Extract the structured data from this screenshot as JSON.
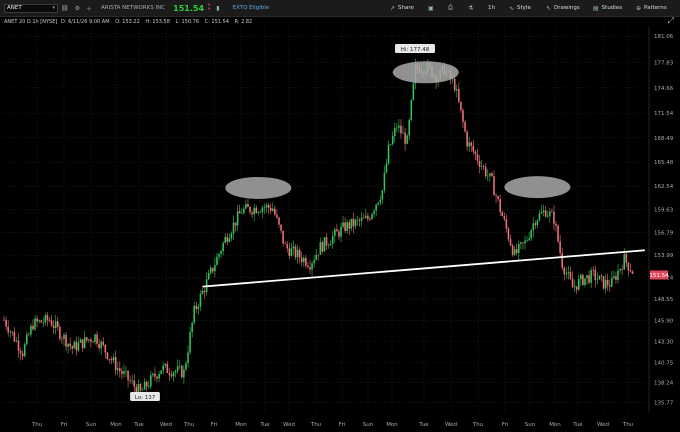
{
  "toolbar": {
    "symbol": "ANET",
    "company_name": "ARISTA NETWORKS INC",
    "last_price": "151.54",
    "extended_label": "EXTO Eligible",
    "share_label": "Share",
    "timeframe_label": "1h",
    "style_label": "Style",
    "drawings_label": "Drawings",
    "studies_label": "Studies",
    "patterns_label": "Patterns"
  },
  "chart_header": {
    "study_label": "ANET 20 D 1h [NYSE]",
    "date": "D: 6/11/26 9:00 AM",
    "open": "O: 153.22",
    "high": "H: 153.58",
    "low": "L: 150.76",
    "close": "C: 151.54",
    "range": "R: 2.82"
  },
  "chart_data": {
    "type": "candlestick",
    "x_labels": [
      "Thu",
      "Fri",
      "Sun",
      "Mon",
      "Tue",
      "Wed",
      "Thu",
      "Fri",
      "Mon",
      "Tue",
      "Wed",
      "Thu",
      "Fri",
      "Sun",
      "Mon",
      "Tue",
      "Wed",
      "Thu",
      "Fri",
      "Sun",
      "Mon",
      "Tue",
      "Wed",
      "Thu",
      "Fri"
    ],
    "y_ticks": [
      181.06,
      177.83,
      174.66,
      171.54,
      168.49,
      165.48,
      162.54,
      159.63,
      156.79,
      153.99,
      151.24,
      148.55,
      145.9,
      143.3,
      140.75,
      138.24,
      135.77
    ],
    "ylim": [
      134.6,
      182.2
    ],
    "high_label": "Hi: 177.48",
    "low_label": "Lo: 137",
    "last_price_tag": "151.54",
    "grid": true,
    "anchors": [
      [
        0,
        146
      ],
      [
        9,
        142
      ],
      [
        14,
        145.5
      ],
      [
        22,
        146
      ],
      [
        33,
        142.5
      ],
      [
        44,
        144
      ],
      [
        55,
        140
      ],
      [
        66,
        137
      ],
      [
        76,
        140
      ],
      [
        87,
        139.5
      ],
      [
        92,
        147
      ],
      [
        97,
        150
      ],
      [
        107,
        156
      ],
      [
        115,
        159.5
      ],
      [
        125,
        160
      ],
      [
        130,
        159.8
      ],
      [
        136,
        155
      ],
      [
        148,
        153
      ],
      [
        153,
        155
      ],
      [
        165,
        157.5
      ],
      [
        176,
        158.5
      ],
      [
        183,
        162
      ],
      [
        186,
        167
      ],
      [
        190,
        170
      ],
      [
        195,
        168
      ],
      [
        199,
        177
      ],
      [
        204,
        177.3
      ],
      [
        210,
        176
      ],
      [
        213,
        177
      ],
      [
        218,
        175
      ],
      [
        224,
        168
      ],
      [
        229,
        166
      ],
      [
        236,
        163
      ],
      [
        242,
        158
      ],
      [
        247,
        154
      ],
      [
        252,
        155.5
      ],
      [
        257,
        158.5
      ],
      [
        262,
        159.5
      ],
      [
        266,
        158.5
      ],
      [
        270,
        153
      ],
      [
        275,
        150
      ],
      [
        280,
        151
      ],
      [
        285,
        151.5
      ],
      [
        290,
        150.5
      ],
      [
        294,
        150.5
      ],
      [
        300,
        153.5
      ],
      [
        304,
        152
      ]
    ],
    "annotations": [
      {
        "type": "ellipse",
        "label": "left-shoulder",
        "x_index": 123,
        "price": 162.3
      },
      {
        "type": "ellipse",
        "label": "head",
        "x_index": 204,
        "price": 176.6
      },
      {
        "type": "ellipse",
        "label": "right-shoulder",
        "x_index": 258,
        "price": 162.4
      },
      {
        "type": "neckline",
        "from": [
          96,
          150.1
        ],
        "to": [
          310,
          154.6
        ]
      }
    ]
  },
  "colors": {
    "up": "#33c35a",
    "down": "#f07078",
    "neckline": "#ffffff",
    "ellipse": "#a9a9a9",
    "grid": "#262626",
    "price_tag": "#e0475b"
  }
}
